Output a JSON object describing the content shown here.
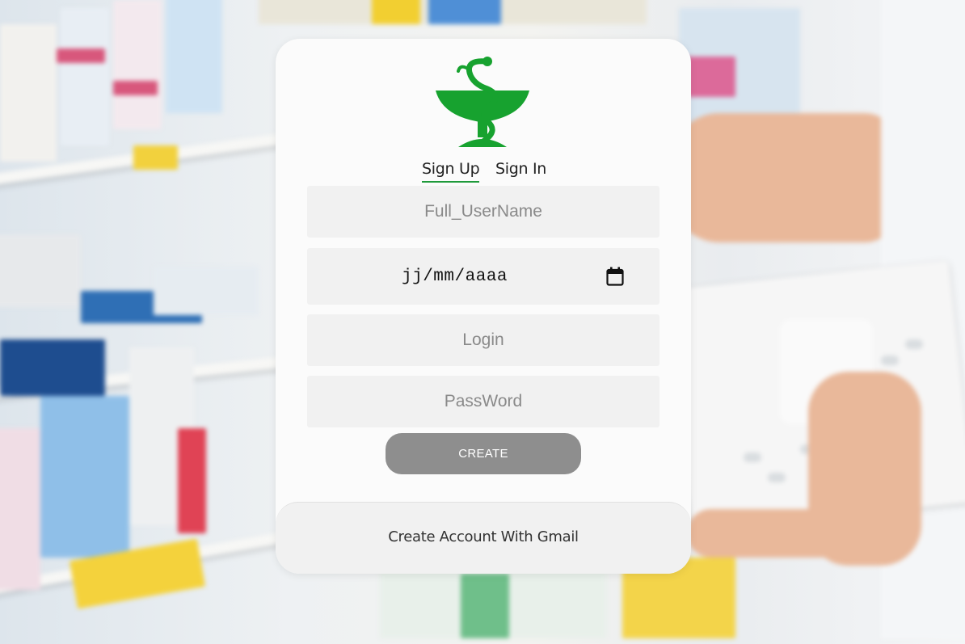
{
  "tabs": {
    "signup": "Sign Up",
    "signin": "Sign In"
  },
  "form": {
    "fullname_placeholder": "Full_UserName",
    "date_format": "jj/mm/aaaa",
    "login_placeholder": "Login",
    "password_placeholder": "PassWord",
    "create_label": "CREATE"
  },
  "gmail": {
    "label": "Create Account With Gmail"
  },
  "icons": {
    "logo": "pharmacy-bowl-of-hygieia-icon",
    "calendar": "calendar-icon"
  },
  "colors": {
    "brand_green": "#1f9a3b",
    "button_gray": "#8e8e8e",
    "field_bg": "#f1f1f1"
  }
}
